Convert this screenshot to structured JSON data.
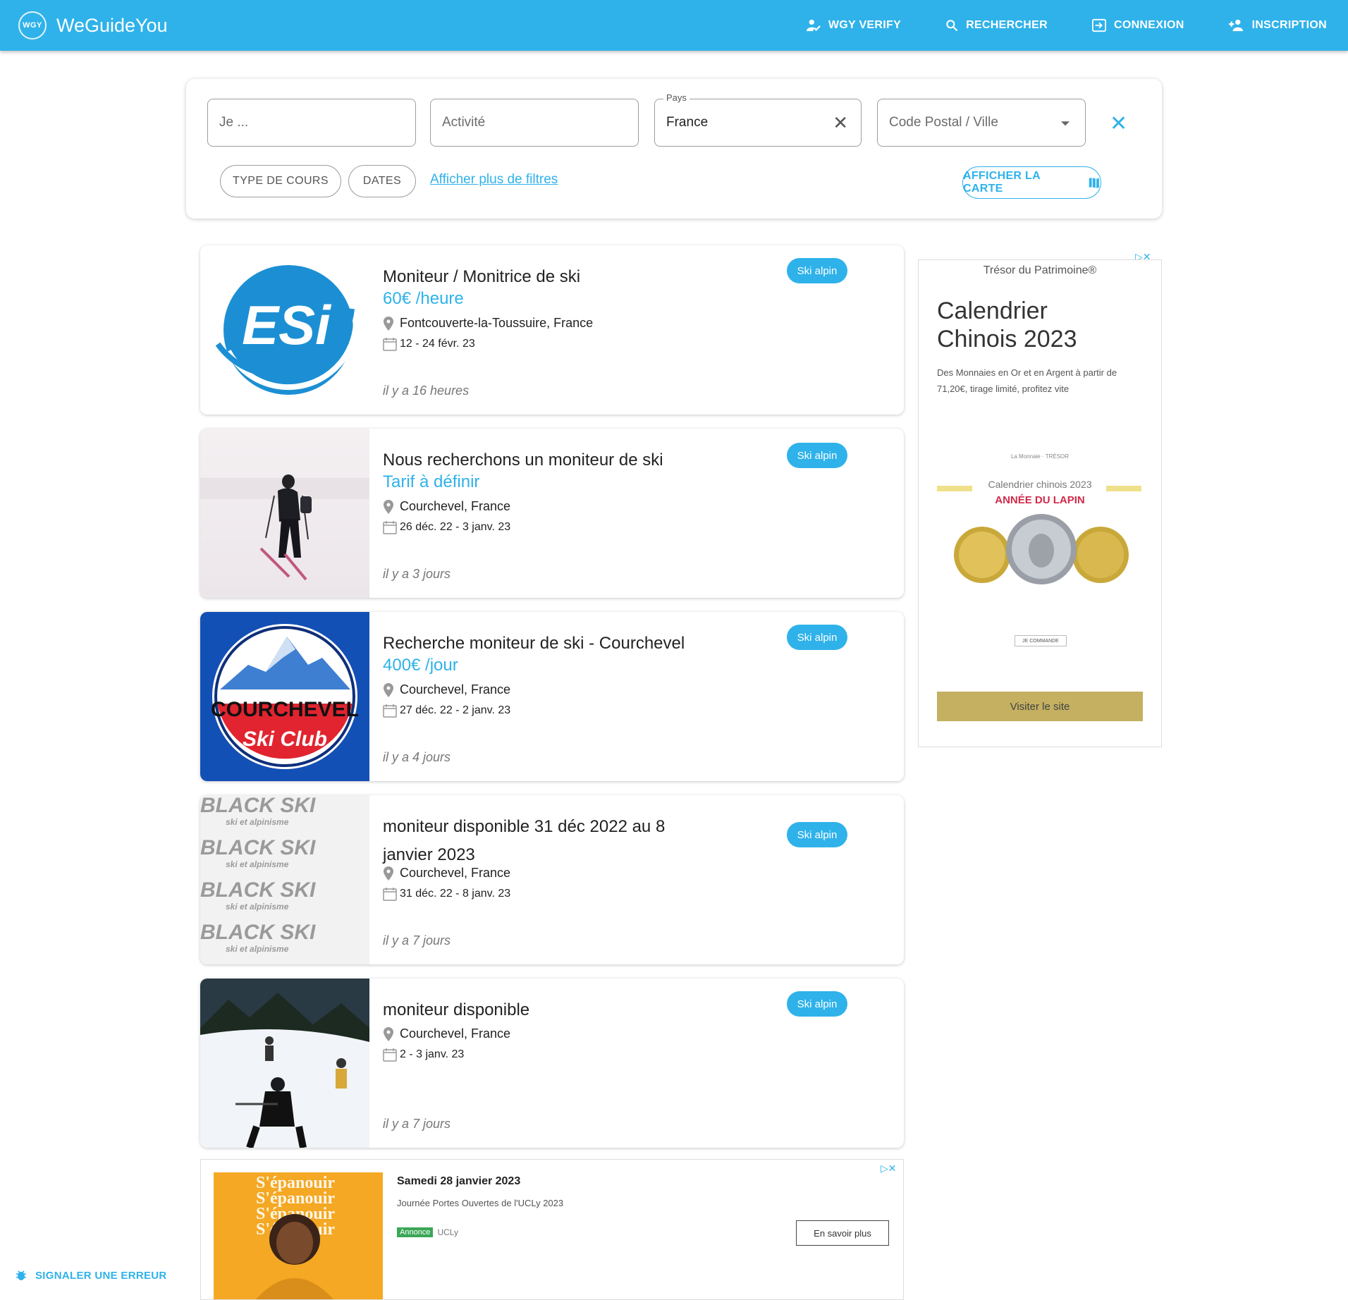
{
  "brand": {
    "logo_text": "WGY",
    "name": "WeGuideYou"
  },
  "nav": [
    {
      "label": "WGY VERIFY",
      "icon": "verified-user-icon"
    },
    {
      "label": "RECHERCHER",
      "icon": "search-icon"
    },
    {
      "label": "CONNEXION",
      "icon": "login-icon"
    },
    {
      "label": "INSCRIPTION",
      "icon": "person-add-icon"
    }
  ],
  "search": {
    "je_placeholder": "Je ...",
    "activite_placeholder": "Activité",
    "pays_legend": "Pays",
    "pays_value": "France",
    "ville_placeholder": "Code Postal / Ville",
    "chip_type": "TYPE DE COURS",
    "chip_dates": "DATES",
    "more_filters": "Afficher plus de filtres",
    "map_button": "AFFICHER LA CARTE"
  },
  "listings": [
    {
      "title": "Moniteur / Monitrice de ski",
      "price": "60€ /heure",
      "location": "Fontcouverte-la-Toussuire, France",
      "dates": "12 - 24 févr. 23",
      "ago": "il y a 16 heures",
      "badge": "Ski alpin",
      "image": "esi-logo",
      "logo_text": "ESi"
    },
    {
      "title": "Nous recherchons un moniteur de ski",
      "price": "Tarif à définir",
      "location": "Courchevel, France",
      "dates": "26 déc. 22 - 3 janv. 23",
      "ago": "il y a 3 jours",
      "badge": "Ski alpin",
      "image": "skier-photo"
    },
    {
      "title": "Recherche moniteur de ski - Courchevel",
      "price": "400€ /jour",
      "location": "Courchevel, France",
      "dates": "27 déc. 22 - 2 janv. 23",
      "ago": "il y a 4 jours",
      "badge": "Ski alpin",
      "image": "courchevel-ski-club-logo",
      "logo_line1": "COURCHEVEL",
      "logo_line2": "Ski Club"
    },
    {
      "title": "moniteur disponible 31 déc 2022 au 8 janvier 2023",
      "price": "",
      "location": "Courchevel, France",
      "dates": "31 déc. 22 - 8 janv. 23",
      "ago": "il y a 7 jours",
      "badge": "Ski alpin",
      "image": "black-ski-logo",
      "logo_line1": "BLACK SKI",
      "logo_line2": "ski et alpinisme"
    },
    {
      "title": "moniteur disponible",
      "price": "",
      "location": "Courchevel, France",
      "dates": "2 - 3 janv. 23",
      "ago": "il y a 7 jours",
      "badge": "Ski alpin",
      "image": "ski-group-photo"
    }
  ],
  "ad_right": {
    "brand": "Trésor du Patrimoine®",
    "title_line1": "Calendrier",
    "title_line2": "Chinois 2023",
    "description": "Des Monnaies en Or et en Argent à partir de 71,20€, tirage limité, profitez vite",
    "tiny_logo": "La Monnaie · TRÉSOR",
    "band_text": "Calendrier chinois 2023",
    "band_highlight": "ANNÉE DU LAPIN",
    "order_button": "JE COMMANDE",
    "visit_button": "Visiter le site",
    "colors": {
      "gold": "#c4b060",
      "red": "#d02a4a"
    }
  },
  "ad_bottom": {
    "date_title": "Samedi 28 janvier 2023",
    "subtitle": "Journée Portes Ouvertes de l'UCLy 2023",
    "tag": "Annonce",
    "advertiser": "UCLy",
    "button": "En savoir plus",
    "image_text": "S'épanouir"
  },
  "report_error": "SIGNALER UNE ERREUR",
  "colors": {
    "primary": "#2fb2ea"
  }
}
